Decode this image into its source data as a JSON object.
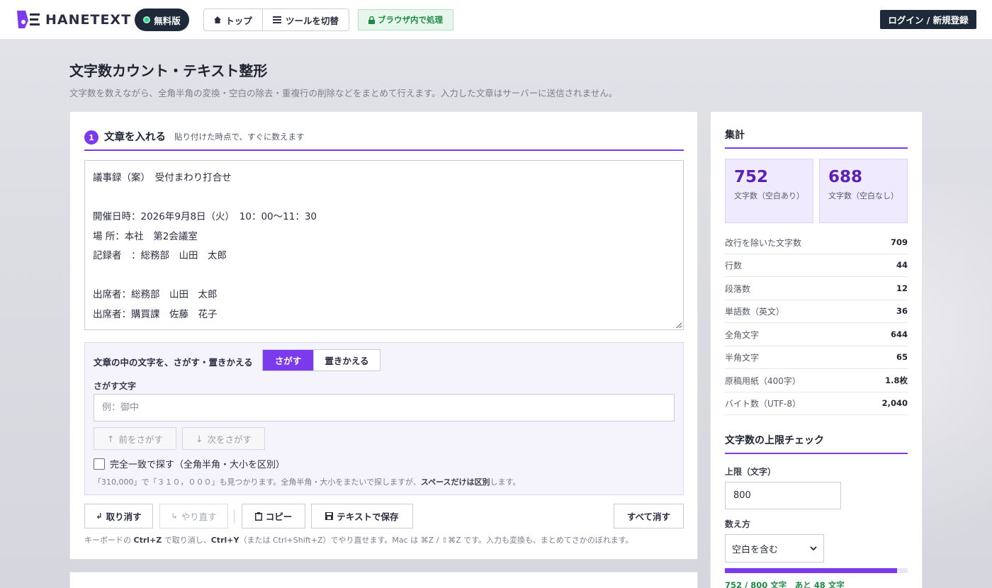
{
  "header": {
    "logo_text": "HANETEXT",
    "free_badge": "無料版",
    "nav_top": "トップ",
    "nav_switch": "ツールを切替",
    "secure_badge": "ブラウザ内で処理",
    "login": "ログイン / 新規登録"
  },
  "page": {
    "title": "文字数カウント・テキスト整形",
    "description": "文字数を数えながら、全角半角の変換・空白の除去・重複行の削除などをまとめて行えます。入力した文章はサーバーに送信されません。"
  },
  "input_section": {
    "step": "1",
    "title": "文章を入れる",
    "subtitle": "貼り付けた時点で、すぐに数えます",
    "lines": [
      "議事録（案）　受付まわり打合せ",
      "",
      "開催日時：2026年9月8日（火）　10：00〜11：30",
      "場 所：本社　第2会議室",
      "記録者　：総務部　山田　太郎",
      "",
      "出席者：総務部　山田　太郎",
      "出席者：購買課　佐藤　花子"
    ]
  },
  "search": {
    "title": "文章の中の文字を、さがす・置きかえる",
    "mode_find": "さがす",
    "mode_replace": "置きかえる",
    "find_label": "さがす文字",
    "find_placeholder": "例：御中",
    "prev": "前をさがす",
    "next": "次をさがす",
    "exact_match": "完全一致で探す（全角半角・大小を区別）",
    "hint_pre": "「310,000」で「３１０，０００」も見つかります。全角半角・大小をまたいで探しますが、",
    "hint_bold": "スペースだけは区別",
    "hint_post": "します。"
  },
  "actions": {
    "undo": "取り消す",
    "redo": "やり直す",
    "copy": "コピー",
    "save": "テキストで保存",
    "clear_all": "すべて消す"
  },
  "keyboard_hint": {
    "p1": "キーボードの ",
    "k1": "Ctrl+Z",
    "p2": " で取り消し、",
    "k2": "Ctrl+Y",
    "p3": "（または Ctrl+Shift+Z）でやり直せます。Mac は ⌘Z / ⇧⌘Z です。入力も変換も、まとめてさかのぼれます。"
  },
  "summary": {
    "title": "集計",
    "with_spaces_value": "752",
    "with_spaces_label": "文字数（空白あり）",
    "without_spaces_value": "688",
    "without_spaces_label": "文字数（空白なし）",
    "stats": [
      {
        "label": "改行を除いた文字数",
        "value": "709"
      },
      {
        "label": "行数",
        "value": "44"
      },
      {
        "label": "段落数",
        "value": "12"
      },
      {
        "label": "単語数（英文）",
        "value": "36"
      },
      {
        "label": "全角文字",
        "value": "644"
      },
      {
        "label": "半角文字",
        "value": "65"
      },
      {
        "label": "原稿用紙（400字）",
        "value": "1.8枚"
      },
      {
        "label": "バイト数（UTF-8）",
        "value": "2,040"
      }
    ]
  },
  "limit": {
    "title": "文字数の上限チェック",
    "limit_label": "上限（文字）",
    "limit_value": "800",
    "method_label": "数え方",
    "method_value": "空白を含む",
    "progress": 0.94,
    "progress_text": "752 / 800 文字　あと 48 文字"
  },
  "colors": {
    "accent": "#7c3aed",
    "dark": "#1e2a3a",
    "success": "#1f8a45"
  }
}
